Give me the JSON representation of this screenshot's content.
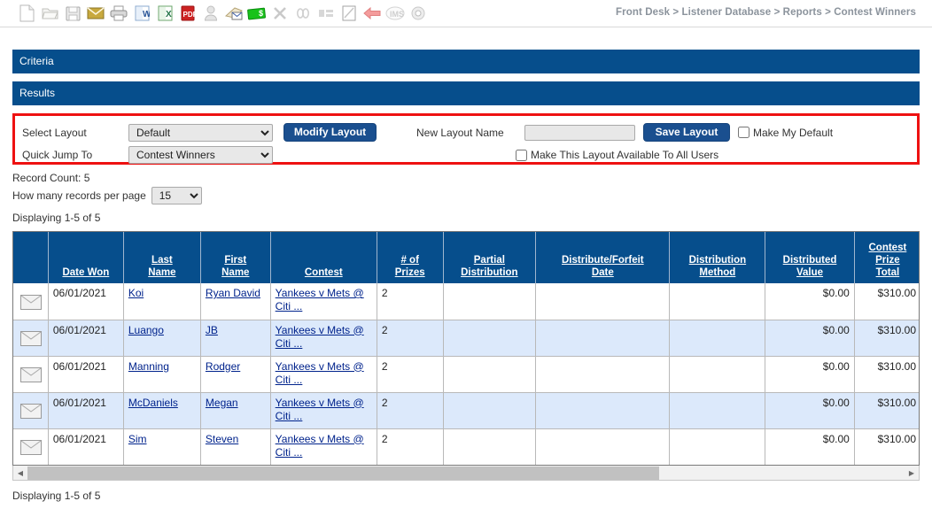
{
  "toolbar": {
    "icons": [
      {
        "name": "new-document-icon",
        "title": "New"
      },
      {
        "name": "open-folder-icon",
        "title": "Open"
      },
      {
        "name": "save-floppy-icon",
        "title": "Save"
      },
      {
        "name": "email-envelope-icon",
        "title": "Email"
      },
      {
        "name": "print-icon",
        "title": "Print"
      },
      {
        "name": "export-word-icon",
        "title": "Export to Word"
      },
      {
        "name": "export-excel-icon",
        "title": "Export to Excel"
      },
      {
        "name": "export-pdf-icon",
        "title": "Export to PDF"
      },
      {
        "name": "user-icon",
        "title": "User"
      },
      {
        "name": "mail-merge-icon",
        "title": "Mail Merge"
      },
      {
        "name": "money-cash-icon",
        "title": "Payment"
      },
      {
        "name": "delete-x-icon",
        "title": "Delete"
      },
      {
        "name": "link-chain-icon",
        "title": "Link"
      },
      {
        "name": "list-icon",
        "title": "List"
      },
      {
        "name": "edit-note-icon",
        "title": "Edit"
      },
      {
        "name": "back-arrow-icon",
        "title": "Back"
      },
      {
        "name": "info-badge-icon",
        "title": "Info"
      },
      {
        "name": "settings-gear-icon",
        "title": "Settings"
      }
    ],
    "breadcrumb": "Front Desk > Listener Database > Reports > Contest Winners"
  },
  "sections": {
    "criteria_label": "Criteria",
    "results_label": "Results"
  },
  "layout_panel": {
    "select_layout_label": "Select Layout",
    "select_layout_value": "Default",
    "select_layout_options": [
      "Default"
    ],
    "modify_layout_button": "Modify Layout",
    "new_layout_name_label": "New Layout Name",
    "new_layout_name_value": "",
    "new_layout_name_placeholder": "",
    "save_layout_button": "Save Layout",
    "make_my_default_label": "Make My Default",
    "make_my_default_checked": false,
    "quick_jump_label": "Quick Jump To",
    "quick_jump_value": "Contest Winners",
    "quick_jump_options": [
      "Contest Winners"
    ],
    "available_all_users_label": "Make This Layout Available To All Users",
    "available_all_users_checked": false
  },
  "record_info": {
    "record_count_label": "Record Count: 5",
    "records_per_page_label": "How many records per page",
    "records_per_page_value": "15",
    "records_per_page_options": [
      "15"
    ],
    "displaying_top": "Displaying 1-5 of 5",
    "displaying_bottom": "Displaying 1-5 of 5"
  },
  "table": {
    "columns": [
      {
        "key": "icon",
        "label": "",
        "lines": [
          ""
        ]
      },
      {
        "key": "date",
        "label": "Date Won",
        "lines": [
          "Date Won"
        ]
      },
      {
        "key": "last",
        "label": "Last Name",
        "lines": [
          "Last",
          "Name"
        ]
      },
      {
        "key": "first",
        "label": "First Name",
        "lines": [
          "First",
          "Name"
        ]
      },
      {
        "key": "contest",
        "label": "Contest",
        "lines": [
          "Contest"
        ]
      },
      {
        "key": "prizes",
        "label": "# of Prizes",
        "lines": [
          "# of",
          "Prizes"
        ]
      },
      {
        "key": "partial",
        "label": "Partial Distribution",
        "lines": [
          "Partial",
          "Distribution"
        ]
      },
      {
        "key": "dfdate",
        "label": "Distribute/Forfeit Date",
        "lines": [
          "Distribute/Forfeit",
          "Date"
        ]
      },
      {
        "key": "method",
        "label": "Distribution Method",
        "lines": [
          "Distribution",
          "Method"
        ]
      },
      {
        "key": "dvalue",
        "label": "Distributed Value",
        "lines": [
          "Distributed",
          "Value"
        ]
      },
      {
        "key": "ptotal",
        "label": "Contest Prize Total",
        "lines": [
          "Contest",
          "Prize",
          "Total"
        ]
      }
    ],
    "rows": [
      {
        "date": "06/01/2021",
        "last": "Koi",
        "first": "Ryan David",
        "contest": "Yankees v Mets @ Citi ...",
        "prizes": "2",
        "partial": "",
        "dfdate": "",
        "method": "",
        "dvalue": "$0.00",
        "ptotal": "$310.00"
      },
      {
        "date": "06/01/2021",
        "last": "Luango",
        "first": "JB",
        "contest": "Yankees v Mets @ Citi ...",
        "prizes": "2",
        "partial": "",
        "dfdate": "",
        "method": "",
        "dvalue": "$0.00",
        "ptotal": "$310.00"
      },
      {
        "date": "06/01/2021",
        "last": "Manning",
        "first": "Rodger",
        "contest": "Yankees v Mets @ Citi ...",
        "prizes": "2",
        "partial": "",
        "dfdate": "",
        "method": "",
        "dvalue": "$0.00",
        "ptotal": "$310.00"
      },
      {
        "date": "06/01/2021",
        "last": "McDaniels",
        "first": "Megan",
        "contest": "Yankees v Mets @ Citi ...",
        "prizes": "2",
        "partial": "",
        "dfdate": "",
        "method": "",
        "dvalue": "$0.00",
        "ptotal": "$310.00"
      },
      {
        "date": "06/01/2021",
        "last": "Sim",
        "first": "Steven",
        "contest": "Yankees v Mets @ Citi ...",
        "prizes": "2",
        "partial": "",
        "dfdate": "",
        "method": "",
        "dvalue": "$0.00",
        "ptotal": "$310.00"
      }
    ],
    "row_icon_name": "envelope-icon"
  },
  "scrollbar": {
    "left_arrow": "◀",
    "right_arrow": "▶",
    "thumb_percent": 72
  },
  "colors": {
    "header_blue": "#064E8C",
    "alt_row_blue": "#DCE9FB",
    "link_blue": "#00238C",
    "highlight_red": "#EE1111",
    "button_blue": "#1A4F8F",
    "breadcrumb_gray": "#8B939C"
  }
}
